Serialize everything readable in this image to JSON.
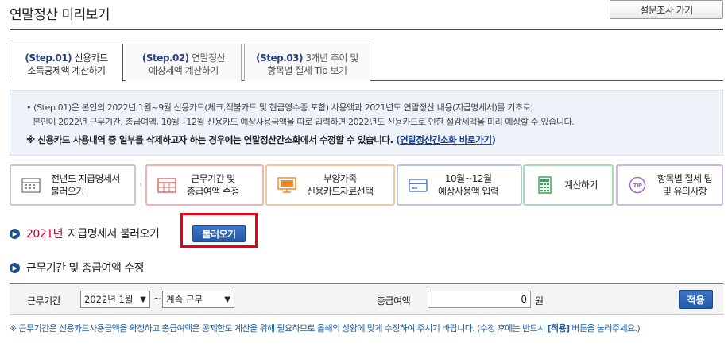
{
  "header": {
    "title": "연말정산 미리보기",
    "survey_button": "설문조사 가기"
  },
  "tabs": [
    {
      "step": "(Step.01)",
      "line1": "신용카드",
      "line2": "소득공제액 계산하기",
      "active": true
    },
    {
      "step": "(Step.02)",
      "line1": "연말정산",
      "line2": "예상세액 계산하기",
      "active": false
    },
    {
      "step": "(Step.03)",
      "line1": "3개년 추이 및",
      "line2": "항목별 절세 Tip 보기",
      "active": false
    }
  ],
  "info": {
    "line1": "• (Step.01)은 본인의 2022년 1월~9월 신용카드(체크,직불카드 및 현금영수증 포함) 사용액과 2021년도 연말정산 내용(지급명세서)를 기초로,",
    "line2": "본인이 2022년 근무기간, 총급여액, 10월~12월 신용카드 예상사용금액을 따로 입력하면 2022년도 신용카드로 인한 절감세액을 미리 예상할 수 있습니다.",
    "note_text": "※ 신용카드 사용내역 중 일부를 삭제하고자 하는 경우에는 연말정산간소화에서 수정할 수 있습니다.",
    "note_open": "(",
    "note_link": "연말정산간소화 바로가기",
    "note_close": ")"
  },
  "steps": [
    {
      "line1": "전년도 지급명세서",
      "line2": "불러오기",
      "icon": "calendar-icon",
      "color": "#8a8a8a"
    },
    {
      "line1": "근무기간 및",
      "line2": "총급여액 수정",
      "icon": "calendar-grid-icon",
      "color": "#e26a6a"
    },
    {
      "line1": "부양가족",
      "line2": "신용카드자료선택",
      "icon": "monitor-icon",
      "color": "#f08a2c"
    },
    {
      "line1": "10월~12월",
      "line2": "예상사용액 입력",
      "icon": "card-icon",
      "color": "#5b7fc4"
    },
    {
      "line1": "계산하기",
      "line2": "",
      "icon": "calculator-icon",
      "color": "#3ca55a"
    },
    {
      "line1": "항목별 절세 팁",
      "line2": "및 유의사항",
      "icon": "tip-icon",
      "color": "#a56ac8"
    }
  ],
  "section1": {
    "year": "2021년",
    "title": "지급명세서 불러오기",
    "button": "불러오기"
  },
  "section2": {
    "title": "근무기간 및 총급여액 수정"
  },
  "form": {
    "period_label": "근무기간",
    "month_select": "2022년 1월",
    "tilde": "~",
    "cont_select": "계속 근무",
    "total_label": "총급여액",
    "total_value": "0",
    "unit": "원",
    "apply_button": "적용"
  },
  "footnote": {
    "text_before": "※ 근무기간은 신용카드사용금액을 확정하고 총급여액은 공제한도 계산을 위해 필요하므로 올해의 상황에 맞게 수정하여 주시기 바랍니다. (수정 후에는 반드시 ",
    "apply": "[적용]",
    "text_after": " 버튼을 눌러주세요.)"
  }
}
